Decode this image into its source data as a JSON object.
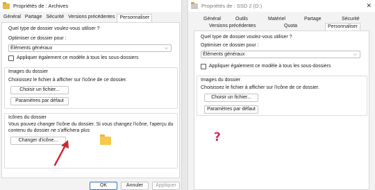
{
  "left_dialog": {
    "title": "Propriétés de : Archives",
    "tabs": [
      "Général",
      "Partage",
      "Sécurité",
      "Versions précédentes",
      "Personnaliser"
    ],
    "active_tab": "Personnaliser",
    "question": "Quel type de dossier voulez-vous utiliser ?",
    "optimize_label": "Optimiser ce dossier pour :",
    "optimize_value": "Éléments généraux",
    "apply_checkbox": "Appliquer également ce modèle à tous les sous-dossiers",
    "images_group": "Images du dossier",
    "images_desc": "Choisissez le fichier à afficher sur l'icône de ce dossier.",
    "choose_file_btn": "Choisir un fichier...",
    "restore_default_btn": "Paramètres par défaut",
    "icons_group": "Icônes du dossier",
    "icons_desc_line1": "Vous pouvez changer l'icône du dossier. Si vous changez l'icône, l'aperçu du",
    "icons_desc_line2": "contenu du dossier ne s'affichera plus",
    "change_icon_btn": "Changer d'icône...",
    "ok_btn": "OK",
    "cancel_btn": "Annuler",
    "apply_btn": "Appliquer"
  },
  "right_dialog": {
    "title": "Propriétés de : SSD 2 (D:)",
    "tabs_row1": [
      "Général",
      "Outils",
      "Matériel",
      "Partage",
      "Sécurité"
    ],
    "tabs_row2": [
      "Versions précédentes",
      "Quota",
      "Personnaliser"
    ],
    "active_tab": "Personnaliser",
    "question": "Quel type de dossier voulez-vous utiliser ?",
    "optimize_label": "Optimiser ce dossier pour :",
    "optimize_value": "Éléments généraux",
    "apply_checkbox": "Appliquer également ce modèle à tous les sous-dossiers",
    "images_group": "Images du dossier",
    "images_desc": "Choisissez le fichier à afficher sur l'icône de ce dossier.",
    "choose_file_btn": "Choisir un fichier...",
    "restore_default_btn": "Paramètres par défaut"
  },
  "annotation": {
    "question_mark": "?",
    "arrow_color": "#d0262f",
    "question_color": "#d62a5a"
  },
  "colors": {
    "dialog_bg": "#f3f3f3",
    "panel_bg": "#ffffff",
    "accent": "#3a6fb7",
    "folder": "#f6c84c"
  }
}
